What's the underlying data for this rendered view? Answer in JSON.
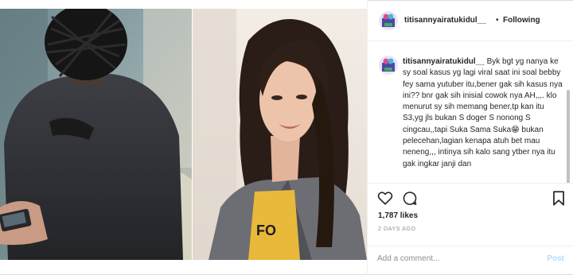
{
  "post": {
    "username": "titisannyairatukidul__",
    "separator": "•",
    "follow_status": "Following"
  },
  "caption": {
    "username": "titisannyairatukidul__",
    "text": " Byk bgt yg nanya ke sy soal kasus yg lagi viral saat ini soal bebby fey sama yutuber itu,bener gak sih kasus nya ini?? bnr gak sih inisial cowok nya AH,,,. klo menurut sy sih memang bener,tp kan itu S3,yg jls bukan S doger S nonong S cingcau,,tapi Suka Sama Suka",
    "emoji": "😁",
    "text_after": " bukan pelecehan,lagian kenapa atuh bet mau neneng,,, intinya sih kalo sang ytber nya itu gak ingkar janji dan"
  },
  "stats": {
    "likes": "1,787 likes",
    "time_ago": "2 DAYS AGO"
  },
  "comment": {
    "placeholder": "Add a comment...",
    "post_label": "Post"
  },
  "icons": {
    "like": "heart-icon",
    "comment": "comment-bubble-icon",
    "save": "bookmark-icon"
  },
  "colors": {
    "post_button": "#b3dbff",
    "muted_text": "#8e8e8e",
    "divider": "#efefef"
  }
}
